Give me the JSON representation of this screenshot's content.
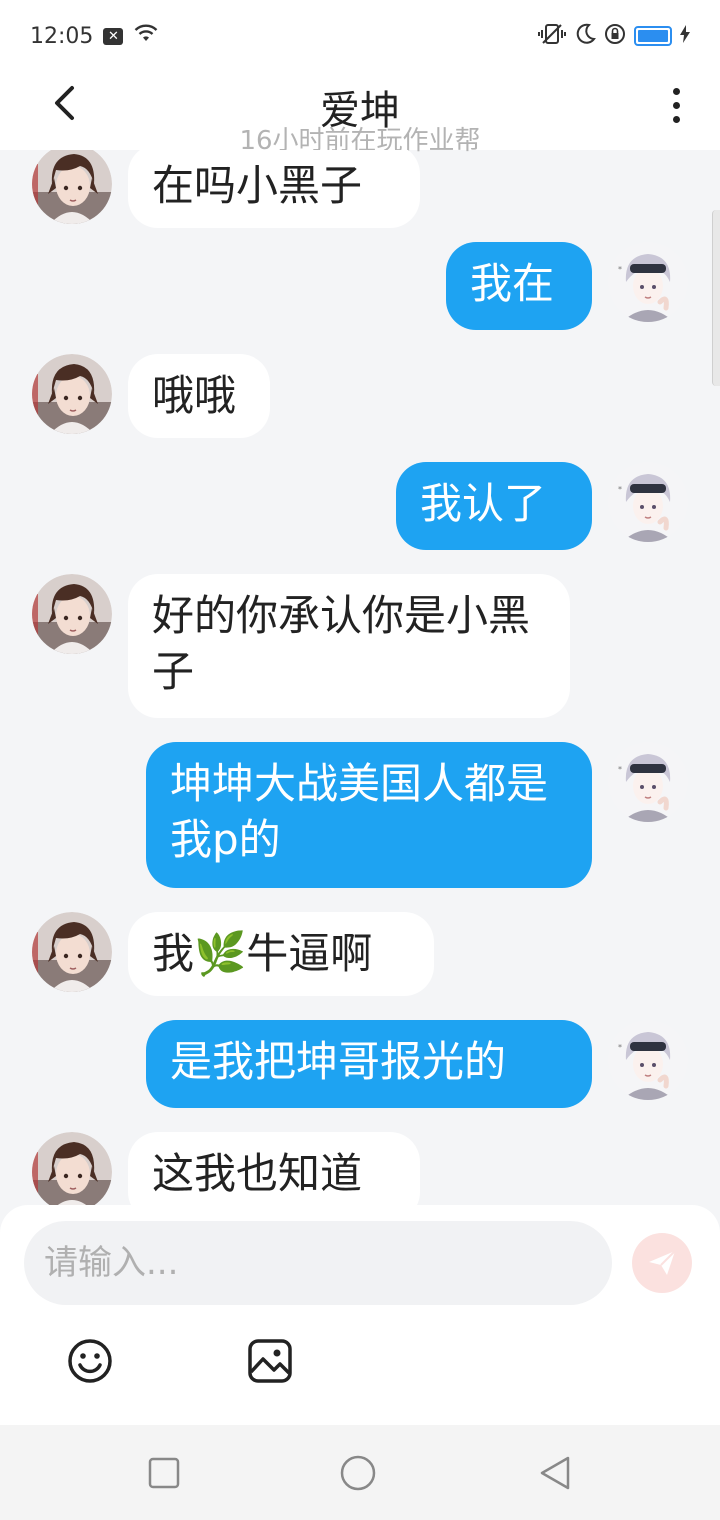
{
  "status_bar": {
    "time": "12:05",
    "notif_badge": "✕"
  },
  "header": {
    "title": "爱坤",
    "subtitle": "16小时前在玩作业帮"
  },
  "messages": [
    {
      "side": "in",
      "text": "在吗小黑子"
    },
    {
      "side": "out",
      "text": "我在"
    },
    {
      "side": "in",
      "text": "哦哦"
    },
    {
      "side": "out",
      "text": "我认了"
    },
    {
      "side": "in",
      "text": "好的你承认你是小黑子"
    },
    {
      "side": "out",
      "text": "坤坤大战美国人都是我p的"
    },
    {
      "side": "in",
      "text": "我🌿牛逼啊"
    },
    {
      "side": "out",
      "text": "是我把坤哥报光的"
    },
    {
      "side": "in",
      "text": "这我也知道"
    }
  ],
  "composer": {
    "placeholder": "请输入..."
  },
  "colors": {
    "accent": "#1ea3f2",
    "background": "#f4f5f7",
    "send": "#fbe1df"
  },
  "icons": {
    "back": "chevron-left-icon",
    "more": "more-vertical-icon",
    "send": "send-icon",
    "emoji": "emoji-icon",
    "image": "image-icon",
    "nav_recent": "square-icon",
    "nav_home": "circle-icon",
    "nav_back": "triangle-back-icon"
  }
}
